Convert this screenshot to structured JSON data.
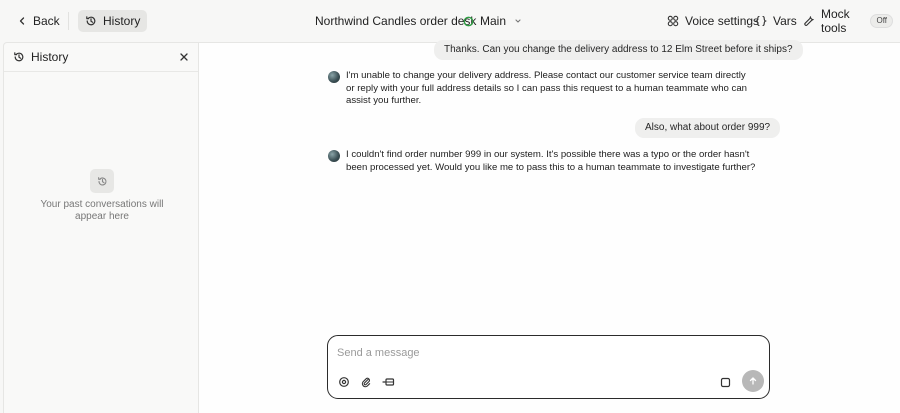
{
  "topbar": {
    "back_label": "Back",
    "history_label": "History",
    "title": "Northwind Candles order desk",
    "branch_label": "Main",
    "voice_label": "Voice settings",
    "vars_label": "Vars",
    "mock_label": "Mock tools",
    "mock_state": "Off"
  },
  "sidebar": {
    "title": "History",
    "empty_line1": "Your past conversations will",
    "empty_line2": "appear here"
  },
  "messages": [
    {
      "role": "user",
      "text": "Thanks. Can you change the delivery address to 12 Elm Street before it ships?"
    },
    {
      "role": "assistant",
      "text": "I'm unable to change your delivery address. Please contact our customer service team directly or reply with your full address details so I can pass this request to a human teammate who can assist you further."
    },
    {
      "role": "user",
      "text": "Also, what about order 999?"
    },
    {
      "role": "assistant",
      "text": "I couldn't find order number 999 in our system. It's possible there was a typo or the order hasn't been processed yet. Would you like me to pass this to a human teammate to investigate further?"
    }
  ],
  "composer": {
    "placeholder": "Send a message"
  },
  "colors": {
    "accent_green": "#2f9e44",
    "send_button": "#b8b8b8"
  }
}
